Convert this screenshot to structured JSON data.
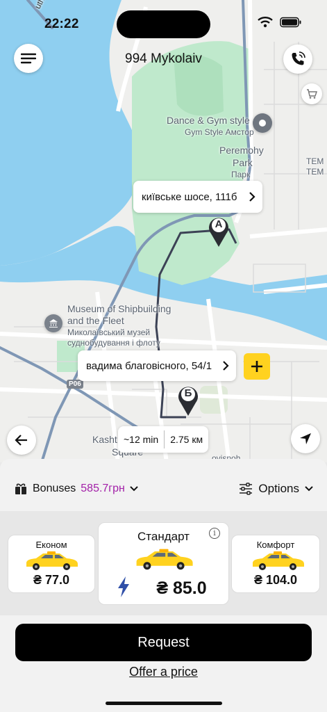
{
  "status": {
    "time": "22:22"
  },
  "header": {
    "city": "994 Mykolaiv"
  },
  "map": {
    "labels": {
      "river": "uth River",
      "poi_dance_en": "Dance & Gym style",
      "poi_dance_ua": "Gym Style Амстор",
      "park_en_1": "Peremohy",
      "park_en_2": "Park",
      "park_ua": "Парк",
      "tem_1": "TEM",
      "tem_2": "TEM",
      "museum_en_1": "Museum of Shipbuilding",
      "museum_en_2": "and the Fleet",
      "museum_ua_1": "Миколаївський музей",
      "museum_ua_2": "суднобудування і флоту",
      "road": "P06",
      "square_1": "Kasht",
      "square_2": "Square",
      "street_partial": "ovisnoh"
    },
    "marker_a": "A",
    "marker_b": "Б",
    "pickup_address": "київське шосе, 111б",
    "dropoff_address": "вадима благовісного, 54/1",
    "eta_time": "~12 min",
    "eta_distance": "2.75 км"
  },
  "bonuses": {
    "label": "Bonuses",
    "amount": "585.7грн"
  },
  "options_label": "Options",
  "tariffs": [
    {
      "name": "Економ",
      "price": "₴ 77.0"
    },
    {
      "name": "Стандарт",
      "price": "₴ 85.0"
    },
    {
      "name": "Комфорт",
      "price": "₴ 104.0"
    }
  ],
  "request_label": "Request",
  "offer_label": "Offer a price",
  "colors": {
    "accent_yellow": "#ffd21f",
    "bonus_purple": "#a21fa8",
    "water": "#8fcff0",
    "park": "#bfe9cc"
  }
}
